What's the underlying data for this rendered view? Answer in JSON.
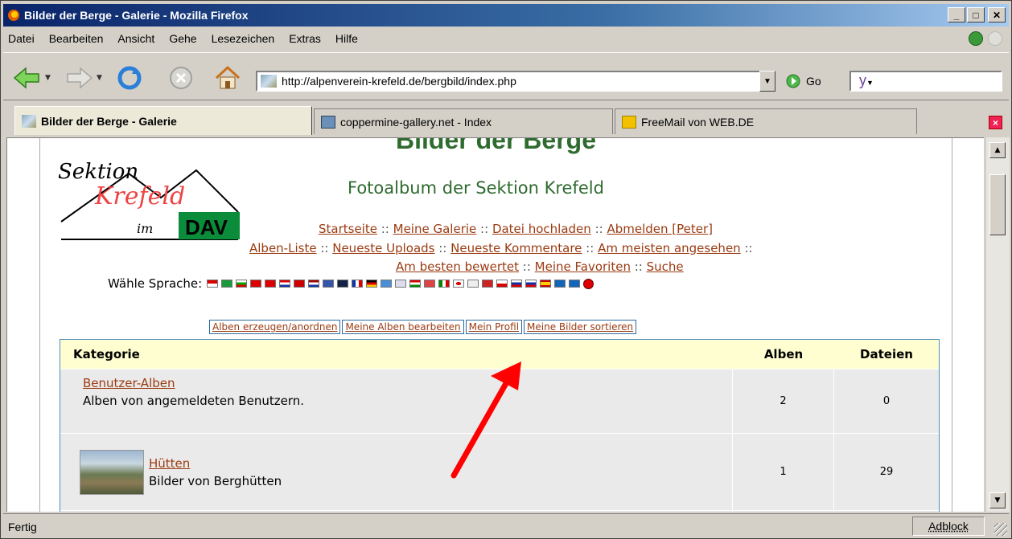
{
  "window": {
    "title": "Bilder der Berge - Galerie - Mozilla Firefox",
    "min": "_",
    "max": "□",
    "close": "✕"
  },
  "menu": [
    "Datei",
    "Bearbeiten",
    "Ansicht",
    "Gehe",
    "Lesezeichen",
    "Extras",
    "Hilfe"
  ],
  "toolbar": {
    "icons": [
      "back-arrow-icon",
      "forward-arrow-icon",
      "reload-icon",
      "stop-icon",
      "home-icon"
    ],
    "url": "http://alpenverein-krefeld.de/bergbild/index.php",
    "go_label": "Go",
    "search_value": "y"
  },
  "tabs": [
    {
      "label": "Bilder der Berge - Galerie",
      "active": true
    },
    {
      "label": "coppermine-gallery.net - Index",
      "active": false
    },
    {
      "label": "FreeMail von WEB.DE",
      "active": false
    }
  ],
  "page": {
    "site_title": "Bilder der Berge",
    "subtitle": "Fotoalbum der Sektion Krefeld",
    "logo": {
      "text1": "Sektion",
      "text2": "Krefeld",
      "text3": "im",
      "badge": "DAV"
    },
    "nav_row1": [
      "Startseite",
      "Meine Galerie",
      "Datei hochladen",
      "Abmelden [Peter]"
    ],
    "nav_row2": [
      "Alben-Liste",
      "Neueste Uploads",
      "Neueste Kommentare",
      "Am meisten angesehen"
    ],
    "nav_row3": [
      "Am besten bewertet",
      "Meine Favoriten",
      "Suche"
    ],
    "separator": "::",
    "lang_label": "Wähle Sprache:",
    "admin_buttons": [
      "Alben erzeugen/anordnen",
      "Meine Alben bearbeiten",
      "Mein Profil",
      "Meine Bilder sortieren"
    ],
    "table": {
      "headers": {
        "category": "Kategorie",
        "albums": "Alben",
        "files": "Dateien"
      },
      "rows": [
        {
          "name": "Benutzer-Alben",
          "desc": "Alben von angemeldeten Benutzern.",
          "albums": "2",
          "files": "0"
        },
        {
          "name": "Hütten",
          "desc": "Bilder von Berghütten",
          "albums": "1",
          "files": "29"
        }
      ]
    }
  },
  "status": {
    "text": "Fertig",
    "adblock": "Adblock"
  },
  "colors": {
    "link": "#9b3a10",
    "green_title": "#2f6b2f",
    "table_border": "#4a8cc0",
    "header_bg": "#fffed0",
    "arrow": "#ff0000"
  }
}
